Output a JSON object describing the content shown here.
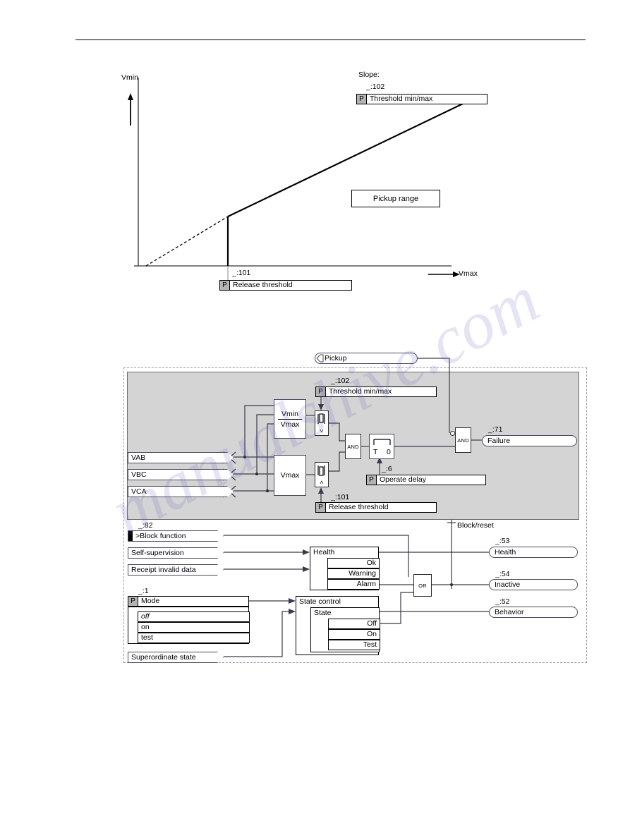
{
  "document": {
    "header_rule": true
  },
  "chart": {
    "y_axis_label": "Vmin",
    "x_axis_label": "Vmax",
    "slope_caption": "Slope:",
    "slope_ref": "_:102",
    "slope_param": {
      "tab": "P",
      "label": "Threshold min/max"
    },
    "release_ref": "_:101",
    "release_param": {
      "tab": "P",
      "label": "Release threshold"
    },
    "pickup_range_label": "Pickup range"
  },
  "chart_data": {
    "type": "line",
    "title": "",
    "xlabel": "Vmax",
    "ylabel": "Vmin",
    "grid": false,
    "legend": "none",
    "xlim": [
      0,
      100
    ],
    "ylim": [
      0,
      100
    ],
    "series": [
      {
        "name": "Threshold min/max (characteristic, extrapolated)",
        "style": "dashed",
        "x": [
          0,
          28
        ],
        "y": [
          0,
          23
        ]
      },
      {
        "name": "Threshold min/max (characteristic)",
        "style": "solid",
        "x": [
          28,
          100
        ],
        "y": [
          23,
          82
        ]
      },
      {
        "name": "Release threshold (vertical boundary)",
        "style": "solid-vertical",
        "x": [
          28,
          28
        ],
        "y": [
          0,
          23
        ]
      }
    ],
    "annotations": [
      {
        "text": "Pickup range",
        "x": 62,
        "y": 38
      },
      {
        "text": "Slope:  _:102  Threshold min/max",
        "x": 72,
        "y": 92
      },
      {
        "text": "_:101  Release threshold",
        "x": 28,
        "y": -8
      }
    ]
  },
  "logic": {
    "pickup_output": {
      "label": "Pickup"
    },
    "threshold_ref": "_:102",
    "threshold_param": {
      "tab": "P",
      "label": "Threshold min/max"
    },
    "release_ref": "_:101",
    "release_param": {
      "tab": "P",
      "label": "Release threshold"
    },
    "operate_delay_ref": "_:6",
    "operate_delay_param": {
      "tab": "P",
      "label": "Operate delay"
    },
    "inputs": [
      {
        "label": "VAB"
      },
      {
        "label": "VBC"
      },
      {
        "label": "VCA"
      }
    ],
    "blocks": {
      "vmin_vmax_numerator": "Vmin",
      "vmin_vmax_denominator": "Vmax",
      "vmax": "Vmax"
    },
    "comparators": [
      {
        "op": "<"
      },
      {
        "op": ">"
      }
    ],
    "gates": {
      "and_1": "AND",
      "and_2": "AND",
      "or_1": "OR"
    },
    "timer": {
      "t_label": "T",
      "value": "0"
    },
    "failure_ref": "_:71",
    "failure_output": {
      "label": "Failure"
    },
    "block_function_ref": "_:82",
    "block_function_input": {
      "label": ">Block function"
    },
    "self_supervision_input": {
      "label": "Self-supervision"
    },
    "receipt_invalid_input": {
      "label": "Receipt invalid data"
    },
    "superordinate_input": {
      "label": "Superordinate state"
    },
    "block_reset_label": "Block/reset",
    "mode_ref": "_:1",
    "mode_param": {
      "tab": "P",
      "label": "Mode"
    },
    "mode_options": [
      "off",
      "on",
      "test"
    ],
    "health_block": {
      "title": "Health",
      "rows": [
        "Ok",
        "Warning",
        "Alarm"
      ]
    },
    "state_control_block": {
      "title": "State control",
      "sub_title": "State",
      "rows": [
        "Off",
        "On",
        "Test"
      ]
    },
    "outputs": [
      {
        "ref": "_:53",
        "label": "Health"
      },
      {
        "ref": "_:54",
        "label": "Inactive"
      },
      {
        "ref": "_:52",
        "label": "Behavior"
      }
    ]
  },
  "colors": {
    "wire": "#3a3a4a",
    "grey_panel": "#d4d4d4",
    "param_tab": "#b4b4b4",
    "ink": "#000000"
  }
}
